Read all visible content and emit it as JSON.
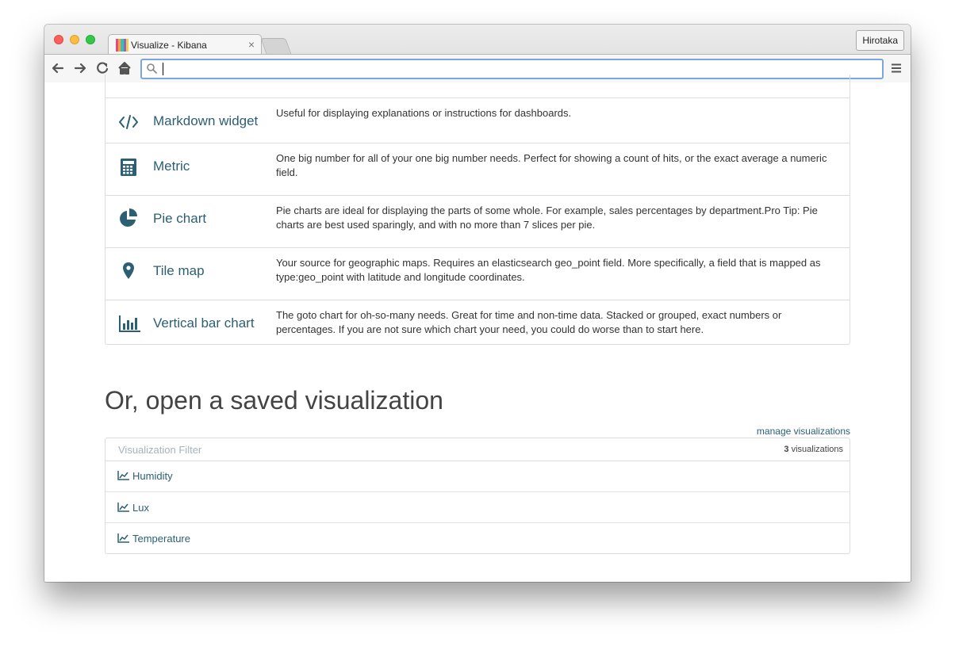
{
  "browser": {
    "tab_title": "Visualize - Kibana",
    "tab_close": "×",
    "profile_name": "Hirotaka",
    "address_value": "",
    "favicon_colors": [
      "#e8478b",
      "#f9a52c",
      "#3ebeb0",
      "#8c63cf",
      "#f4d03f"
    ]
  },
  "vis_types": [
    {
      "icon": "code-icon",
      "name": "Markdown widget",
      "description": "Useful for displaying explanations or instructions for dashboards."
    },
    {
      "icon": "calculator-icon",
      "name": "Metric",
      "description": "One big number for all of your one big number needs. Perfect for showing a count of hits, or the exact average a numeric field."
    },
    {
      "icon": "pie-chart-icon",
      "name": "Pie chart",
      "description": "Pie charts are ideal for displaying the parts of some whole. For example, sales percentages by department.Pro Tip: Pie charts are best used sparingly, and with no more than 7 slices per pie."
    },
    {
      "icon": "map-marker-icon",
      "name": "Tile map",
      "description": "Your source for geographic maps. Requires an elasticsearch geo_point field. More specifically, a field that is mapped as type:geo_point with latitude and longitude coordinates."
    },
    {
      "icon": "bar-chart-icon",
      "name": "Vertical bar chart",
      "description": "The goto chart for oh-so-many needs. Great for time and non-time data. Stacked or grouped, exact numbers or percentages. If you are not sure which chart your need, you could do worse than to start here."
    }
  ],
  "saved": {
    "heading": "Or, open a saved visualization",
    "manage_link": "manage visualizations",
    "filter_placeholder": "Visualization Filter",
    "count": "3",
    "count_label": " visualizations",
    "items": [
      {
        "icon": "line-chart-icon",
        "label": "Humidity"
      },
      {
        "icon": "line-chart-icon",
        "label": "Lux"
      },
      {
        "icon": "line-chart-icon",
        "label": "Temperature"
      }
    ]
  },
  "colors": {
    "accent": "#2c5f74",
    "text": "#333333",
    "heading": "#444444",
    "border": "#dcdcdc"
  }
}
